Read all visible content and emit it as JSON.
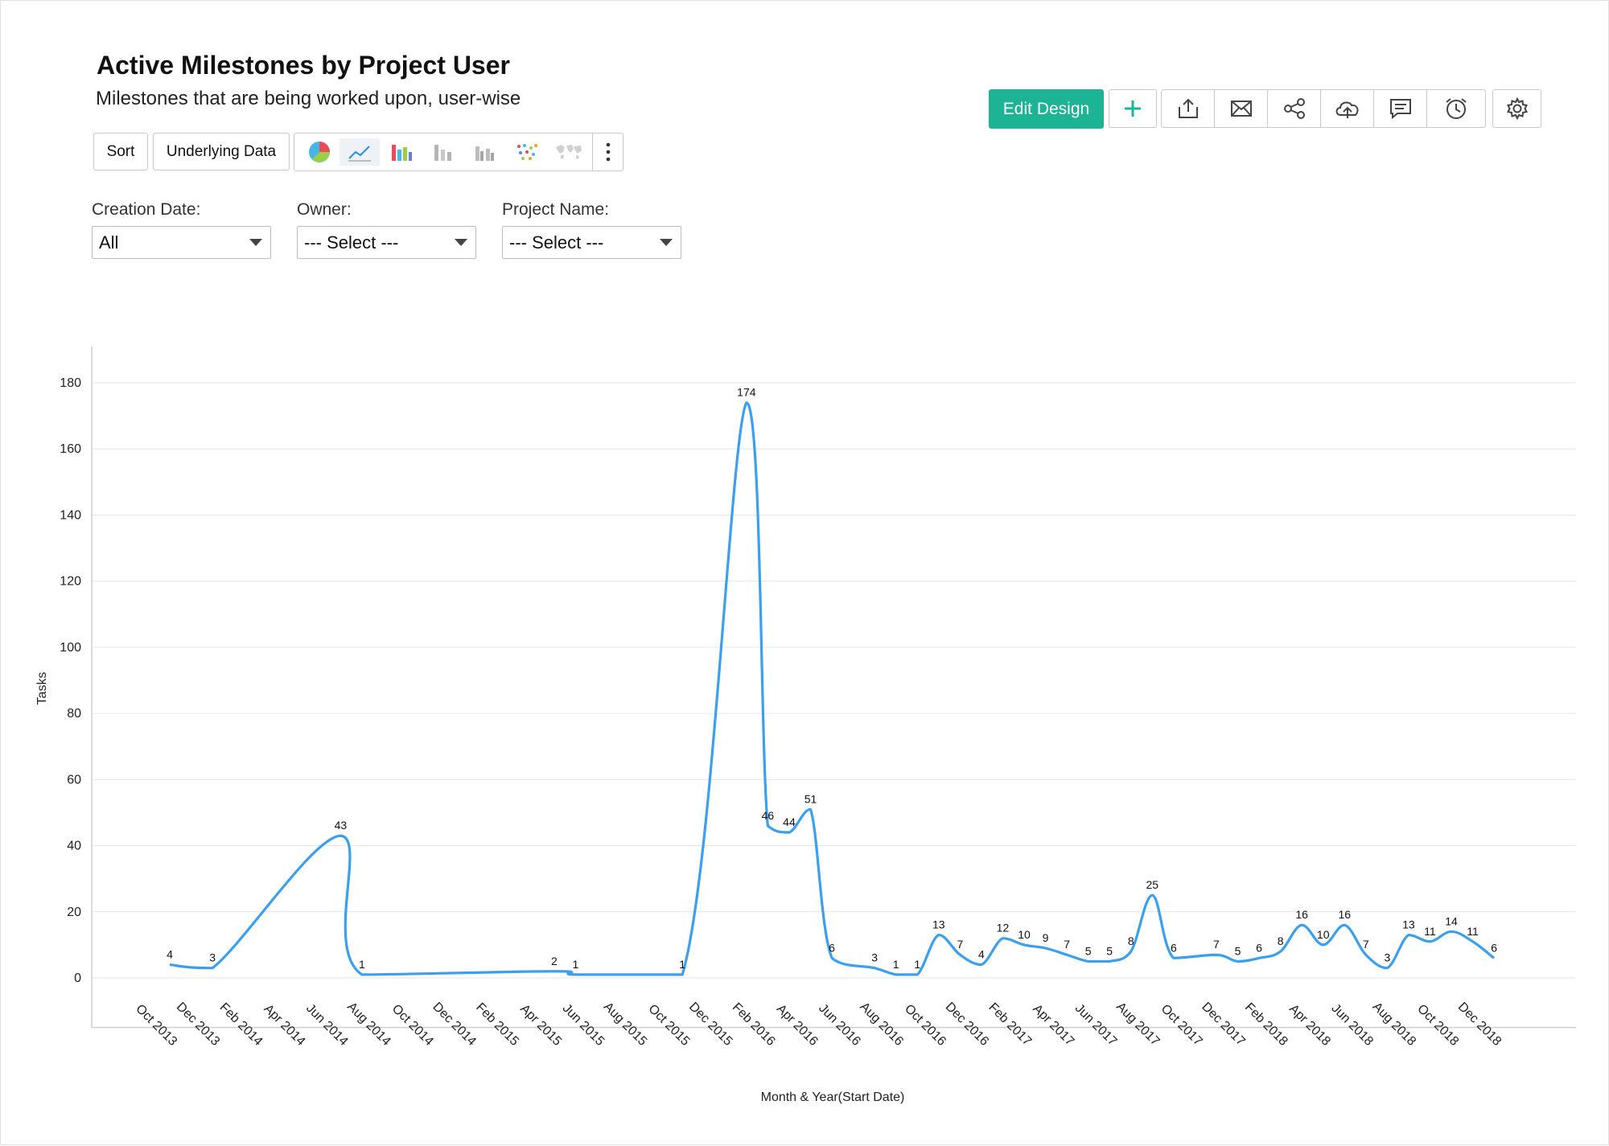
{
  "header": {
    "title": "Active Milestones by Project User",
    "subtitle": "Milestones that are being worked upon, user-wise"
  },
  "toolbar": {
    "sort_label": "Sort",
    "underlying_label": "Underlying Data",
    "edit_design_label": "Edit Design",
    "accent_color": "#1db395",
    "icons": [
      "plus-icon",
      "export-icon",
      "email-icon",
      "share-icon",
      "publish-icon",
      "comment-icon",
      "alarm-icon",
      "settings-icon"
    ],
    "chart_types": [
      "pie-chart-icon",
      "line-chart-icon",
      "bar-chart-icon",
      "stacked-bar-icon",
      "grouped-bar-icon",
      "scatter-icon",
      "map-icon"
    ]
  },
  "filters": [
    {
      "label": "Creation Date:",
      "value": "All"
    },
    {
      "label": "Owner:",
      "value": "--- Select ---"
    },
    {
      "label": "Project Name:",
      "value": "--- Select ---"
    }
  ],
  "chart_data": {
    "type": "line",
    "xlabel": "Month & Year(Start Date)",
    "ylabel": "Tasks",
    "ylim": [
      -15,
      190
    ],
    "yticks": [
      0,
      20,
      40,
      60,
      80,
      100,
      120,
      140,
      160,
      180
    ],
    "grid": true,
    "line_color": "#3b9ff0",
    "tick_labels": [
      "Oct 2013",
      "Dec 2013",
      "Feb 2014",
      "Apr 2014",
      "Jun 2014",
      "Aug 2014",
      "Oct 2014",
      "Dec 2014",
      "Feb 2015",
      "Apr 2015",
      "Jun 2015",
      "Aug 2015",
      "Oct 2015",
      "Dec 2015",
      "Feb 2016",
      "Apr 2016",
      "Jun 2016",
      "Aug 2016",
      "Oct 2016",
      "Dec 2016",
      "Feb 2017",
      "Apr 2017",
      "Jun 2017",
      "Aug 2017",
      "Oct 2017",
      "Dec 2017",
      "Feb 2018",
      "Apr 2018",
      "Jun 2018",
      "Aug 2018",
      "Oct 2018",
      "Dec 2018"
    ],
    "points": [
      {
        "x": "Oct 2013",
        "y": 4
      },
      {
        "x": "Dec 2013",
        "y": 3
      },
      {
        "x": "Jun 2014",
        "y": 43
      },
      {
        "x": "Jul 2014",
        "y": 1
      },
      {
        "x": "Apr 2015",
        "y": 2
      },
      {
        "x": "May 2015",
        "y": 1
      },
      {
        "x": "Oct 2015",
        "y": 1
      },
      {
        "x": "Jan 2016",
        "y": 174
      },
      {
        "x": "Feb 2016",
        "y": 46
      },
      {
        "x": "Mar 2016",
        "y": 44
      },
      {
        "x": "Apr 2016",
        "y": 51
      },
      {
        "x": "May 2016",
        "y": 6
      },
      {
        "x": "Jul 2016",
        "y": 3
      },
      {
        "x": "Aug 2016",
        "y": 1
      },
      {
        "x": "Sep 2016",
        "y": 1
      },
      {
        "x": "Oct 2016",
        "y": 13
      },
      {
        "x": "Nov 2016",
        "y": 7
      },
      {
        "x": "Dec 2016",
        "y": 4
      },
      {
        "x": "Jan 2017",
        "y": 12
      },
      {
        "x": "Feb 2017",
        "y": 10
      },
      {
        "x": "Mar 2017",
        "y": 9
      },
      {
        "x": "Apr 2017",
        "y": 7
      },
      {
        "x": "May 2017",
        "y": 5
      },
      {
        "x": "Jun 2017",
        "y": 5
      },
      {
        "x": "Jul 2017",
        "y": 8
      },
      {
        "x": "Aug 2017",
        "y": 25
      },
      {
        "x": "Sep 2017",
        "y": 6
      },
      {
        "x": "Nov 2017",
        "y": 7
      },
      {
        "x": "Dec 2017",
        "y": 5
      },
      {
        "x": "Jan 2018",
        "y": 6
      },
      {
        "x": "Feb 2018",
        "y": 8
      },
      {
        "x": "Mar 2018",
        "y": 16
      },
      {
        "x": "Apr 2018",
        "y": 10
      },
      {
        "x": "May 2018",
        "y": 16
      },
      {
        "x": "Jun 2018",
        "y": 7
      },
      {
        "x": "Jul 2018",
        "y": 3
      },
      {
        "x": "Aug 2018",
        "y": 13
      },
      {
        "x": "Sep 2018",
        "y": 11
      },
      {
        "x": "Oct 2018",
        "y": 14
      },
      {
        "x": "Nov 2018",
        "y": 11
      },
      {
        "x": "Dec 2018",
        "y": 6
      }
    ]
  }
}
